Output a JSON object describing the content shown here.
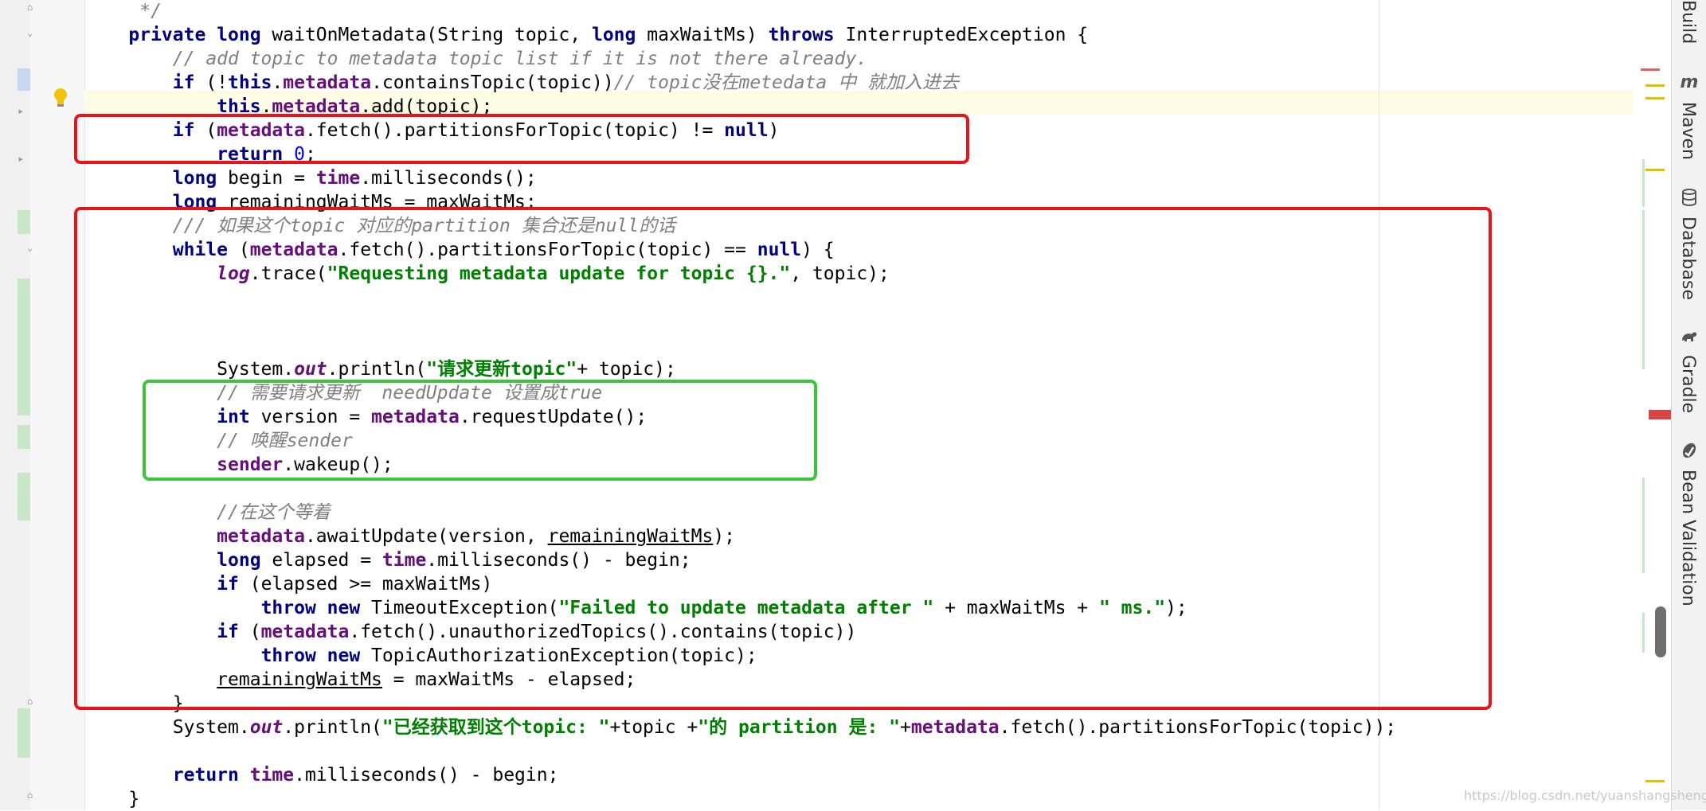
{
  "editor": {
    "lines": [
      [
        {
          "t": "     */",
          "c": "cmt"
        }
      ],
      [
        {
          "t": "    "
        },
        {
          "t": "private long ",
          "c": "kw"
        },
        {
          "t": "waitOnMetadata(String topic, "
        },
        {
          "t": "long ",
          "c": "kw"
        },
        {
          "t": "maxWaitMs) "
        },
        {
          "t": "throws ",
          "c": "kw"
        },
        {
          "t": "InterruptedException {"
        }
      ],
      [
        {
          "t": "        "
        },
        {
          "t": "// add topic to metadata topic list if it is not there already.",
          "c": "cmt"
        }
      ],
      [
        {
          "t": "        "
        },
        {
          "t": "if ",
          "c": "kw"
        },
        {
          "t": "(!"
        },
        {
          "t": "this",
          "c": "kw"
        },
        {
          "t": "."
        },
        {
          "t": "metadata",
          "c": "fld"
        },
        {
          "t": ".containsTopic(topic))"
        },
        {
          "t": "// topic没在metedata 中 就加入进去",
          "c": "cmt"
        }
      ],
      [
        {
          "t": "            "
        },
        {
          "t": "this",
          "c": "kw"
        },
        {
          "t": "."
        },
        {
          "t": "metadata",
          "c": "fld"
        },
        {
          "t": ".add(topic);"
        }
      ],
      [
        {
          "t": "        "
        },
        {
          "t": "if ",
          "c": "kw"
        },
        {
          "t": "("
        },
        {
          "t": "metadata",
          "c": "fld"
        },
        {
          "t": ".fetch().partitionsForTopic(topic) != "
        },
        {
          "t": "null",
          "c": "kw"
        },
        {
          "t": ")"
        }
      ],
      [
        {
          "t": "            "
        },
        {
          "t": "return ",
          "c": "kw"
        },
        {
          "t": "0",
          "c": "num"
        },
        {
          "t": ";"
        }
      ],
      [
        {
          "t": "        "
        },
        {
          "t": "long ",
          "c": "kw"
        },
        {
          "t": "begin = "
        },
        {
          "t": "time",
          "c": "fld"
        },
        {
          "t": ".milliseconds();"
        }
      ],
      [
        {
          "t": "        "
        },
        {
          "t": "long ",
          "c": "kw"
        },
        {
          "t": "remainingWaitMs = maxWaitMs;"
        }
      ],
      [
        {
          "t": "        "
        },
        {
          "t": "/// 如果这个topic 对应的partition 集合还是null的话",
          "c": "cmt"
        }
      ],
      [
        {
          "t": "        "
        },
        {
          "t": "while ",
          "c": "kw"
        },
        {
          "t": "("
        },
        {
          "t": "metadata",
          "c": "fld"
        },
        {
          "t": ".fetch().partitionsForTopic(topic) == "
        },
        {
          "t": "null",
          "c": "kw"
        },
        {
          "t": ") {"
        }
      ],
      [
        {
          "t": "            "
        },
        {
          "t": "log",
          "c": "sfld"
        },
        {
          "t": ".trace("
        },
        {
          "t": "\"Requesting metadata update for topic {}.\"",
          "c": "str"
        },
        {
          "t": ", topic);"
        }
      ],
      [],
      [],
      [],
      [
        {
          "t": "            System."
        },
        {
          "t": "out",
          "c": "sfld"
        },
        {
          "t": ".println("
        },
        {
          "t": "\"请求更新topic\"",
          "c": "str"
        },
        {
          "t": "+ topic);"
        }
      ],
      [
        {
          "t": "            "
        },
        {
          "t": "// 需要请求更新  needUpdate 设置成true",
          "c": "cmt"
        }
      ],
      [
        {
          "t": "            "
        },
        {
          "t": "int ",
          "c": "kw"
        },
        {
          "t": "version = "
        },
        {
          "t": "metadata",
          "c": "fld"
        },
        {
          "t": ".requestUpdate();"
        }
      ],
      [
        {
          "t": "            "
        },
        {
          "t": "// 唤醒sender",
          "c": "cmt"
        }
      ],
      [
        {
          "t": "            "
        },
        {
          "t": "sender",
          "c": "fld"
        },
        {
          "t": ".wakeup();"
        }
      ],
      [],
      [
        {
          "t": "            "
        },
        {
          "t": "//在这个等着",
          "c": "cmt"
        }
      ],
      [
        {
          "t": "            "
        },
        {
          "t": "metadata",
          "c": "fld"
        },
        {
          "t": ".awaitUpdate(version, "
        },
        {
          "t": "remainingWaitMs",
          "c": "ul"
        },
        {
          "t": ");"
        }
      ],
      [
        {
          "t": "            "
        },
        {
          "t": "long ",
          "c": "kw"
        },
        {
          "t": "elapsed = "
        },
        {
          "t": "time",
          "c": "fld"
        },
        {
          "t": ".milliseconds() - begin;"
        }
      ],
      [
        {
          "t": "            "
        },
        {
          "t": "if ",
          "c": "kw"
        },
        {
          "t": "(elapsed >= maxWaitMs)"
        }
      ],
      [
        {
          "t": "                "
        },
        {
          "t": "throw new ",
          "c": "kw"
        },
        {
          "t": "TimeoutException("
        },
        {
          "t": "\"Failed to update metadata after \"",
          "c": "str"
        },
        {
          "t": " + maxWaitMs + "
        },
        {
          "t": "\" ms.\"",
          "c": "str"
        },
        {
          "t": ");"
        }
      ],
      [
        {
          "t": "            "
        },
        {
          "t": "if ",
          "c": "kw"
        },
        {
          "t": "("
        },
        {
          "t": "metadata",
          "c": "fld"
        },
        {
          "t": ".fetch().unauthorizedTopics().contains(topic))"
        }
      ],
      [
        {
          "t": "                "
        },
        {
          "t": "throw new ",
          "c": "kw"
        },
        {
          "t": "TopicAuthorizationException(topic);"
        }
      ],
      [
        {
          "t": "            "
        },
        {
          "t": "remainingWaitMs",
          "c": "ul"
        },
        {
          "t": " = maxWaitMs - elapsed;"
        }
      ],
      [
        {
          "t": "        }"
        }
      ],
      [
        {
          "t": "        System."
        },
        {
          "t": "out",
          "c": "sfld"
        },
        {
          "t": ".println("
        },
        {
          "t": "\"已经获取到这个topic: \"",
          "c": "str"
        },
        {
          "t": "+topic +"
        },
        {
          "t": "\"的 partition 是: \"",
          "c": "str"
        },
        {
          "t": "+"
        },
        {
          "t": "metadata",
          "c": "fld"
        },
        {
          "t": ".fetch().partitionsForTopic(topic));"
        }
      ],
      [],
      [
        {
          "t": "        "
        },
        {
          "t": "return ",
          "c": "kw"
        },
        {
          "t": "time",
          "c": "fld"
        },
        {
          "t": ".milliseconds() - begin;"
        }
      ],
      [
        {
          "t": "    }"
        }
      ]
    ]
  },
  "tool_windows": [
    {
      "label": "Build",
      "icon": ""
    },
    {
      "label": "Maven",
      "icon": "maven-icon"
    },
    {
      "label": "Database",
      "icon": "database-icon"
    },
    {
      "label": "Gradle",
      "icon": "gradle-icon"
    },
    {
      "label": "Bean Validation",
      "icon": "bean-validation-icon"
    }
  ],
  "watermark": "https://blog.csdn.net/yuanshangshenghuo",
  "colors": {
    "keyword": "#000080",
    "field": "#660e7a",
    "string": "#008000",
    "comment": "#808080",
    "number": "#0000ff",
    "annotation_red": "#e8141a",
    "annotation_green": "#3cc43c",
    "current_line": "#fdfce4"
  }
}
